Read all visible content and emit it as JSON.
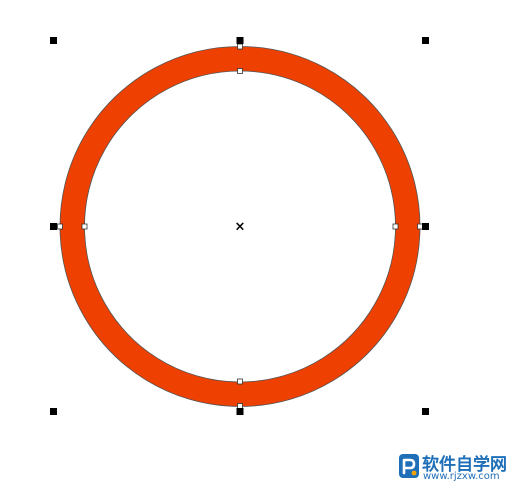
{
  "shape": {
    "type": "ring",
    "fill_color": "#ee4000",
    "outline_color": "#555555",
    "selected": true
  },
  "selection": {
    "handle_color": "#000000",
    "center_mark": "×"
  },
  "watermark": {
    "title": "软件自学网",
    "url": "www.rjzxw.com",
    "logo_color": "#1e6fb8",
    "logo_accent_color": "#f5a300"
  }
}
